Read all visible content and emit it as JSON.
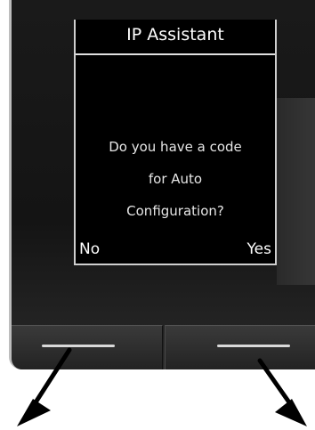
{
  "screen": {
    "title": "IP Assistant",
    "prompt_lines": [
      "Do you have a code",
      "for Auto",
      "Configuration?"
    ]
  },
  "softkeys": {
    "left_label": "No",
    "right_label": "Yes"
  },
  "colors": {
    "display_background": "#000000",
    "display_text": "#ffffff",
    "handset_body": "#1a1a1a"
  }
}
